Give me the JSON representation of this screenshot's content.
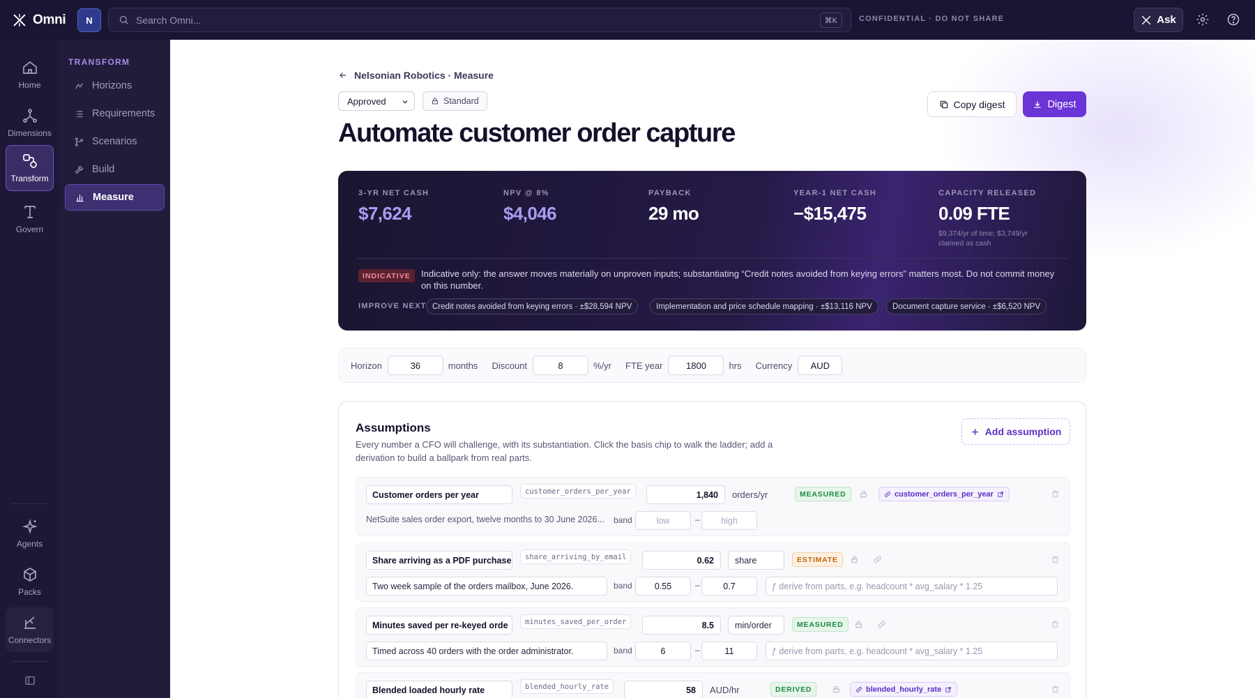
{
  "app": {
    "name": "Omni",
    "workspace_initial": "N"
  },
  "search": {
    "placeholder": "Search Omni...",
    "shortcut": "⌘K"
  },
  "topbar": {
    "confidential": "CONFIDENTIAL · DO NOT SHARE",
    "ask_label": "Ask"
  },
  "rail": {
    "items": [
      {
        "label": "Home",
        "icon": "home-icon"
      },
      {
        "label": "Dimensions",
        "icon": "dimensions-icon"
      },
      {
        "label": "Transform",
        "icon": "transform-icon",
        "active": true
      },
      {
        "label": "Govern",
        "icon": "govern-icon"
      },
      {
        "label": "Agents",
        "icon": "sparkle-icon"
      },
      {
        "label": "Packs",
        "icon": "package-icon"
      },
      {
        "label": "Connectors",
        "icon": "connector-icon"
      }
    ]
  },
  "subnav": {
    "title": "TRANSFORM",
    "items": [
      {
        "label": "Horizons"
      },
      {
        "label": "Requirements"
      },
      {
        "label": "Scenarios"
      },
      {
        "label": "Build"
      },
      {
        "label": "Measure",
        "active": true
      }
    ]
  },
  "page": {
    "breadcrumb": "Nelsonian Robotics · Measure",
    "status": "Approved",
    "tier": "Standard",
    "title": "Automate customer order capture",
    "copy_label": "Copy digest",
    "digest_label": "Digest"
  },
  "metrics": [
    {
      "label": "3-YR NET CASH",
      "value": "$7,624",
      "color": "#a99cf0"
    },
    {
      "label": "NPV @ 8%",
      "value": "$4,046",
      "color": "#a99cf0"
    },
    {
      "label": "PAYBACK",
      "value": "29 mo",
      "color": "#ffffff"
    },
    {
      "label": "YEAR-1 NET CASH",
      "value": "−$15,475",
      "color": "#ffffff"
    },
    {
      "label": "CAPACITY RELEASED",
      "value": "0.09 FTE",
      "color": "#ffffff",
      "note": "$9,374/yr of time; $3,749/yr claimed as cash"
    }
  ],
  "indicative": {
    "badge": "INDICATIVE",
    "text": "Indicative only: the answer moves materially on unproven inputs; substantiating “Credit notes avoided from keying errors” matters most. Do not commit money on this number.",
    "improve_label": "IMPROVE NEXT",
    "chips": [
      "Credit notes avoided from keying errors · ±$28,594 NPV",
      "Implementation and price schedule mapping · ±$13,116 NPV",
      "Document capture service · ±$6,520 NPV"
    ]
  },
  "settings": {
    "horizon_label": "Horizon",
    "horizon": "36",
    "horizon_unit": "months",
    "discount_label": "Discount",
    "discount": "8",
    "discount_unit": "%/yr",
    "fte_label": "FTE year",
    "fte": "1800",
    "fte_unit": "hrs",
    "currency_label": "Currency",
    "currency": "AUD"
  },
  "assumptions": {
    "title": "Assumptions",
    "description": "Every number a CFO will challenge, with its substantiation. Click the basis chip to walk the ladder; add a derivation to build a ballpark from real parts.",
    "add_label": "Add assumption",
    "band_label": "band",
    "low_placeholder": "low",
    "high_placeholder": "high",
    "derive_placeholder": "ƒ derive from parts, e.g. headcount * avg_salary * 1.25",
    "rows": [
      {
        "name": "Customer orders per year",
        "key": "customer_orders_per_year",
        "value": "1,840",
        "unit": "orders/yr",
        "basis": "MEASURED",
        "link": "customer_orders_per_year",
        "note": "NetSuite sales order export, twelve months to 30 June 2026..."
      },
      {
        "name": "Share arriving as a PDF purchase",
        "key": "share_arriving_by_email",
        "value": "0.62",
        "unit": "share",
        "basis": "ESTIMATE",
        "note": "Two week sample of the orders mailbox, June 2026.",
        "low": "0.55",
        "high": "0.7"
      },
      {
        "name": "Minutes saved per re-keyed orde",
        "key": "minutes_saved_per_order",
        "value": "8.5",
        "unit": "min/order",
        "basis": "MEASURED",
        "note": "Timed across 40 orders with the order administrator.",
        "low": "6",
        "high": "11"
      },
      {
        "name": "Blended loaded hourly rate",
        "key": "blended_hourly_rate",
        "value": "58",
        "unit": "AUD/hr",
        "basis": "DERIVED",
        "link": "blended_hourly_rate"
      }
    ]
  }
}
